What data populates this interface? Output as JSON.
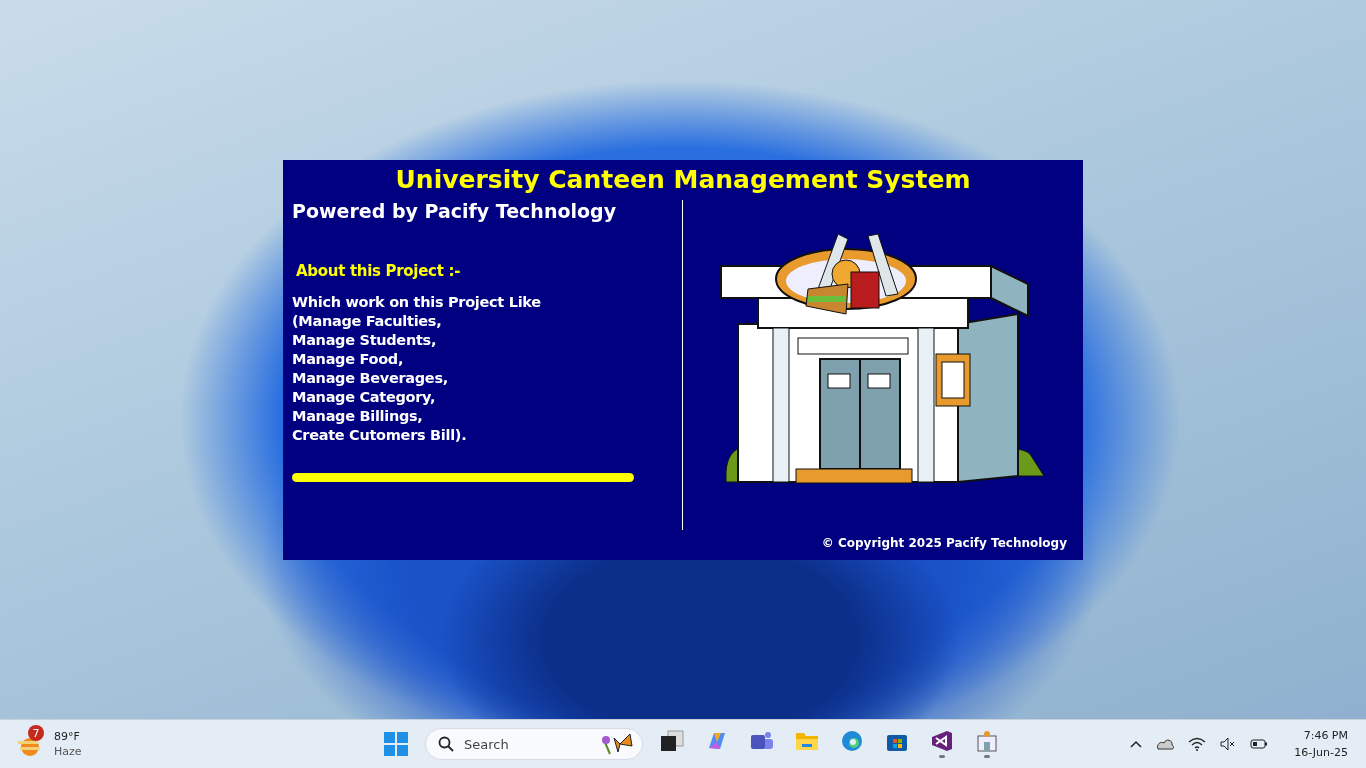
{
  "splash": {
    "title": "University Canteen Management System",
    "powered_by": "Powered by Pacify Technology",
    "about_heading": "About this Project :-",
    "description": "Which work on this Project Like\n(Manage Faculties,\nManage Students,\nManage Food,\nManage Beverages,\nManage Category,\nManage Billings,\nCreate Cutomers Bill).",
    "copyright": "© Copyright 2025 Pacify Technology"
  },
  "taskbar": {
    "weather": {
      "badge": "7",
      "temperature": "89°F",
      "condition": "Haze"
    },
    "search": {
      "placeholder": "Search"
    },
    "apps": [
      {
        "kind": "taskview",
        "running": false
      },
      {
        "kind": "copilot",
        "running": false
      },
      {
        "kind": "teams",
        "running": false
      },
      {
        "kind": "explorer",
        "running": false
      },
      {
        "kind": "edge",
        "running": false
      },
      {
        "kind": "store",
        "running": false
      },
      {
        "kind": "studio",
        "running": true
      },
      {
        "kind": "canteen",
        "running": true
      }
    ],
    "time": "7:46 PM",
    "date": "16-Jun-25"
  }
}
